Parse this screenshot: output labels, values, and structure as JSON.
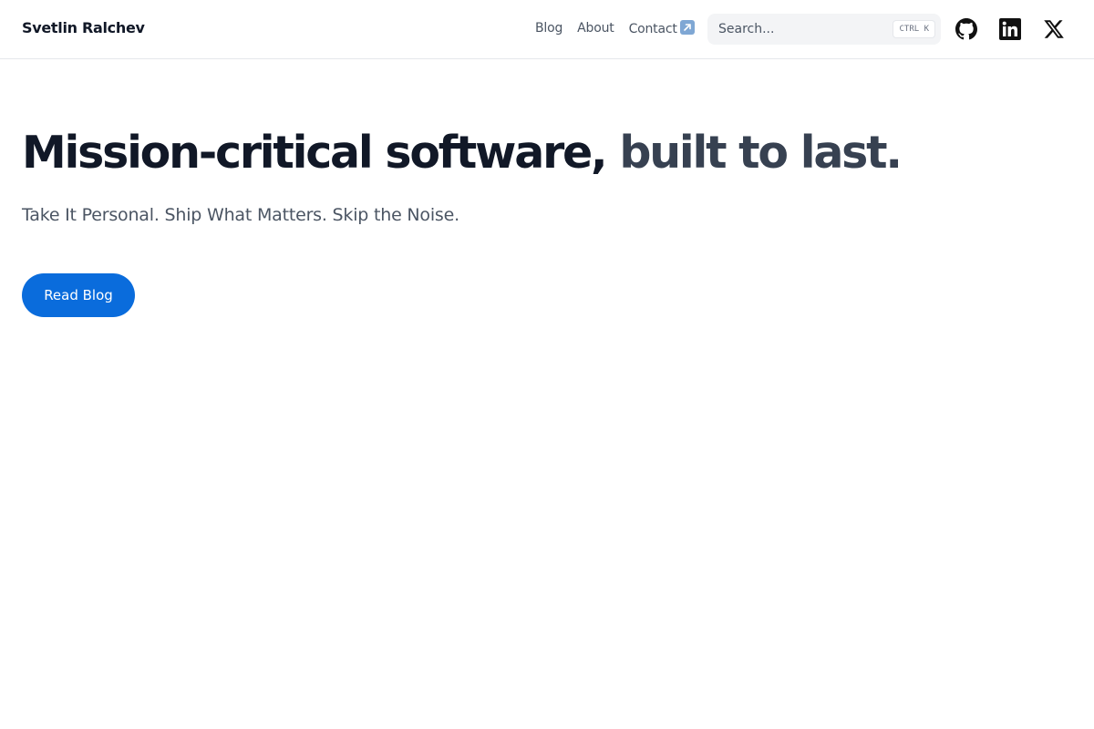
{
  "header": {
    "site_title": "Svetlin Ralchev",
    "nav": {
      "blog": "Blog",
      "about": "About",
      "contact": "Contact",
      "contact_icon": "external-link-arrow-icon"
    },
    "search": {
      "placeholder": "Search...",
      "shortcut": "CTRL K"
    },
    "social": {
      "github_icon": "github-icon",
      "linkedin_icon": "linkedin-icon",
      "x_icon": "x-icon"
    }
  },
  "hero": {
    "headline_main": "Mission-critical software,",
    "headline_accent": " built to last.",
    "tagline": "Take It Personal. Ship What Matters. Skip the Noise.",
    "cta_label": "Read Blog"
  },
  "colors": {
    "primary": "#0a6cdc",
    "text": "#111827",
    "accent_text": "#374151",
    "muted": "#4b5563"
  }
}
